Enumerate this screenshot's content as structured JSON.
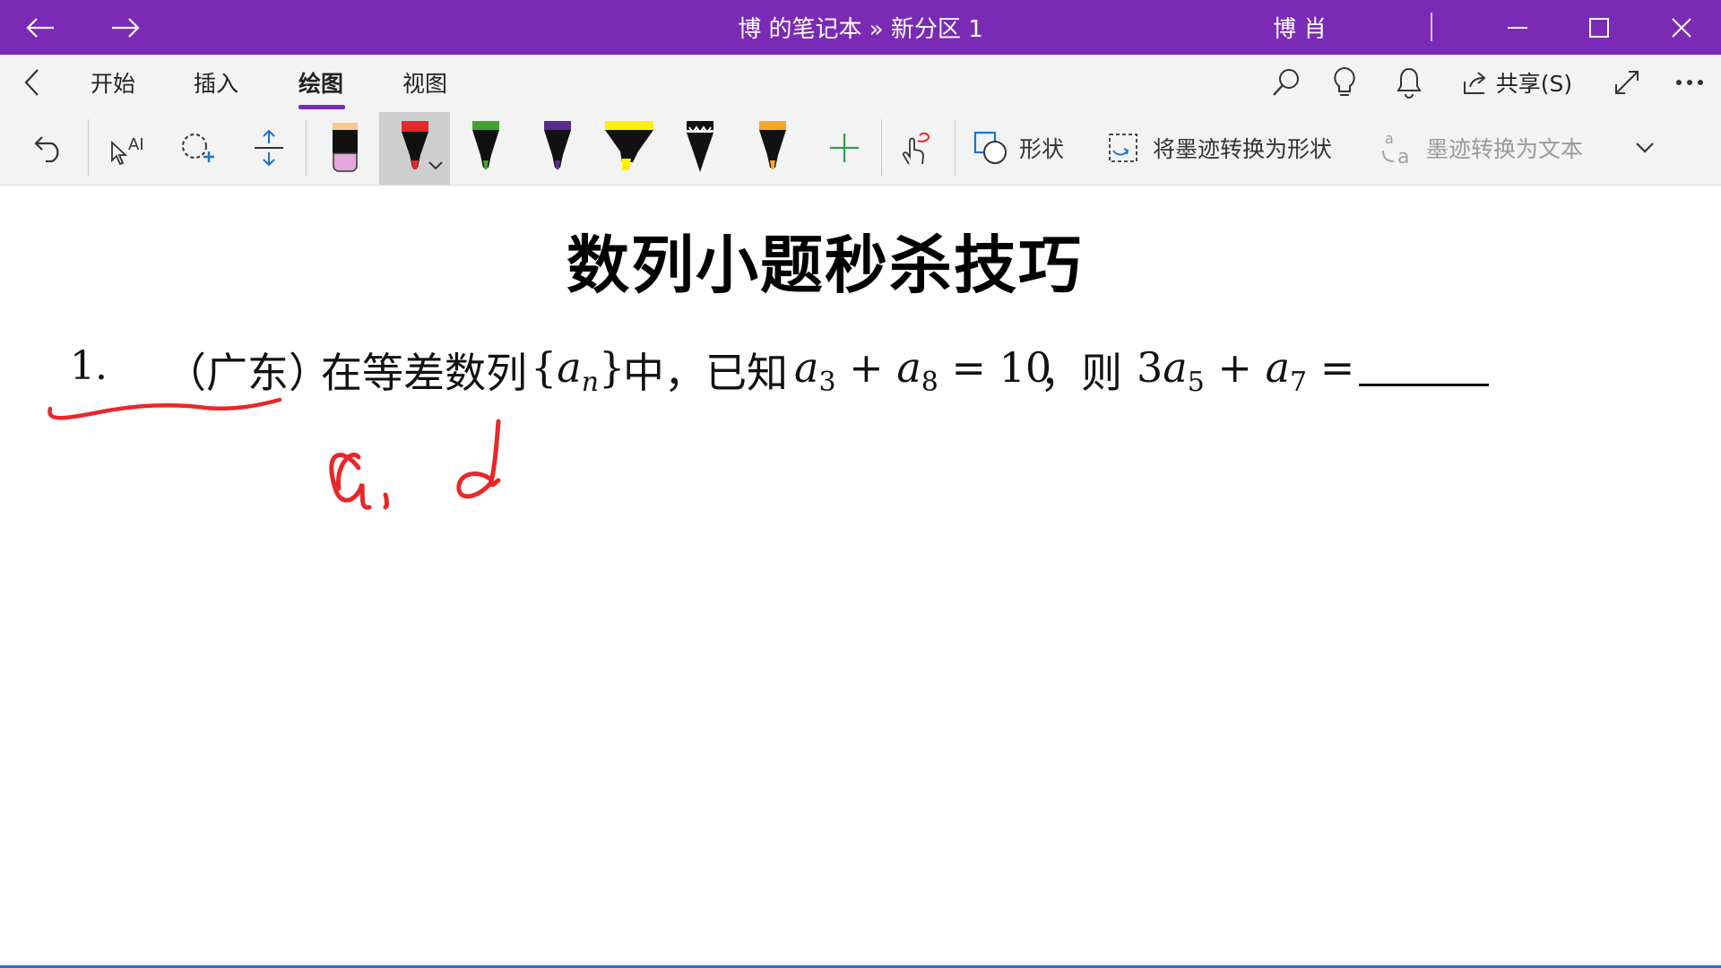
{
  "window": {
    "title": "博 的笔记本 » 新分区 1",
    "user": "博 肖"
  },
  "tabs": [
    {
      "label": "开始"
    },
    {
      "label": "插入"
    },
    {
      "label": "绘图"
    },
    {
      "label": "视图"
    }
  ],
  "active_tab": "绘图",
  "header_actions": {
    "share_label": "共享(S)"
  },
  "toolbar": {
    "shapes_label": "形状",
    "ink_to_shape_label": "将墨迹转换为形状",
    "ink_to_text_label": "墨迹转换为文本"
  },
  "pens": [
    {
      "name": "eraser",
      "color": "#E4A8DD"
    },
    {
      "name": "red-pen",
      "color": "#E8272A"
    },
    {
      "name": "green-pen",
      "color": "#3EA52A"
    },
    {
      "name": "purple-pen",
      "color": "#5B2A8E"
    },
    {
      "name": "yellow-highlighter",
      "color": "#FFF000"
    },
    {
      "name": "galaxy-pen",
      "color": "#000000"
    },
    {
      "name": "gold-pen",
      "color": "#F5A623"
    }
  ],
  "colors": {
    "titlebar": "#7B2AB6",
    "accent": "#7B2AB6",
    "ink": "#E8272A",
    "add_pen": "#2E9E4F"
  },
  "page": {
    "title": "数列小题秒杀技巧",
    "question": {
      "number": "1.",
      "source": "（广东）",
      "text_a": "在等差数列",
      "text_b": "中，已知",
      "text_c": "，则"
    }
  },
  "handwriting": "a₁、d"
}
